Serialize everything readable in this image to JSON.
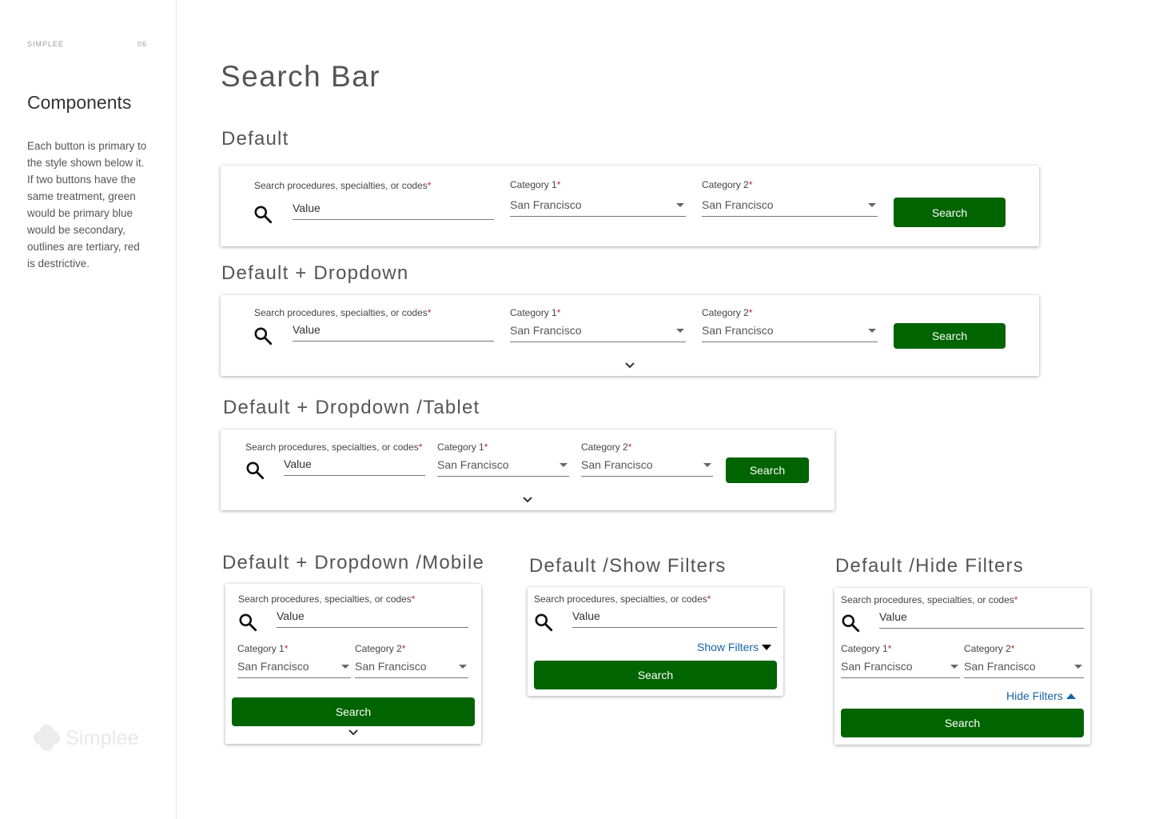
{
  "sidebar": {
    "brand": "SIMPLEE",
    "page_number": "06",
    "title": "Components",
    "description": "Each button is primary to the style shown below it. If two buttons have the same treatment, green would be primary blue would be secondary, outlines are tertiary, red is destrictive.",
    "logo_text": "Simplee"
  },
  "main": {
    "title": "Search Bar",
    "sections": {
      "default": "Default",
      "default_dropdown": "Default + Dropdown",
      "tablet": "Default + Dropdown /Tablet",
      "mobile": "Default + Dropdown /Mobile",
      "show_filters": "Default /Show Filters",
      "hide_filters": "Default /Hide Filters"
    }
  },
  "form": {
    "search_label": "Search procedures, specialties, or codes",
    "required_mark": "*",
    "search_value": "Value",
    "category1_label": "Category 1",
    "category2_label": "Category 2",
    "category_value": "San Francisco",
    "search_button": "Search",
    "show_filters": "Show Filters",
    "hide_filters": "Hide Filters"
  },
  "icons": {
    "search": "search-icon",
    "dropdown": "caret-down-icon",
    "expand": "chevron-down-icon"
  },
  "colors": {
    "primary_green": "#006400",
    "link_blue": "#1565a8",
    "required_red": "#c62828"
  }
}
